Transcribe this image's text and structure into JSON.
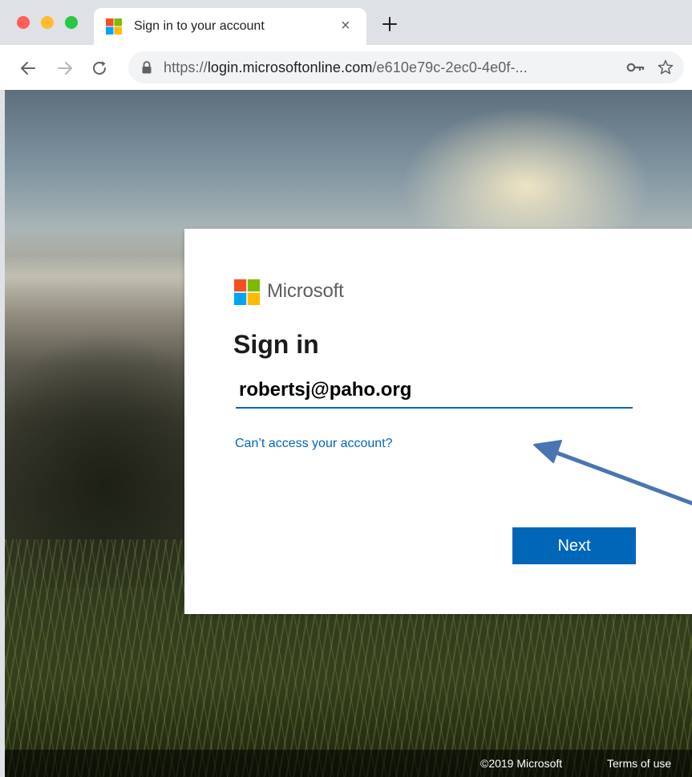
{
  "browser": {
    "tab": {
      "title": "Sign in to your account",
      "close_glyph": "×",
      "favicon": "microsoft-logo"
    },
    "new_tab_icon": "plus-icon",
    "nav": {
      "back_icon": "arrow-left-icon",
      "forward_icon": "arrow-right-icon",
      "reload_icon": "reload-icon"
    },
    "address_bar": {
      "scheme": "https://",
      "host": "login.microsoftonline.com",
      "path": "/e610e79c-2ec0-4e0f-...",
      "lock_icon": "lock-icon",
      "key_icon": "key-icon",
      "bookmark_icon": "star-icon"
    }
  },
  "signin": {
    "brand": "Microsoft",
    "title": "Sign in",
    "email_value": "robertsj@paho.org",
    "cant_access_link": "Can’t access your account?",
    "next_label": "Next"
  },
  "footer": {
    "copyright": "©2019 Microsoft",
    "terms": "Terms of use"
  },
  "colors": {
    "accent": "#0067b8",
    "annotation_arrow": "#4a74b4",
    "ms_red": "#f25022",
    "ms_green": "#7fba00",
    "ms_blue": "#00a4ef",
    "ms_yellow": "#ffb900"
  }
}
